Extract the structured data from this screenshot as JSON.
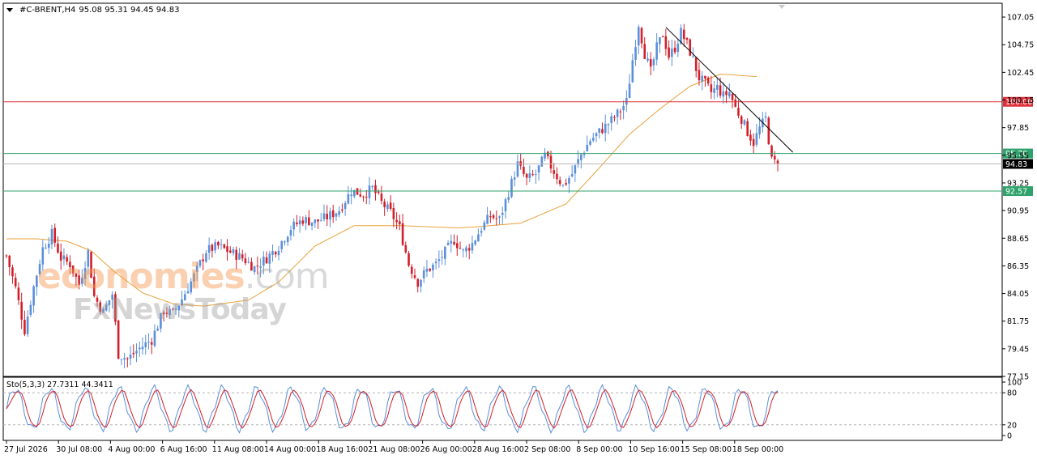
{
  "header": {
    "symbol": "#C-BRENT,H4",
    "ohlc": "95.08 95.31 94.45 94.83"
  },
  "watermark": {
    "brand_main": "economies",
    "brand_suffix": ".com",
    "brand_secondary": "FxNewsToday"
  },
  "chart_data": [
    {
      "type": "candlestick",
      "title": "#C-BRENT,H4",
      "ylim": [
        77.15,
        108.2
      ],
      "y_ticks": [
        "107.05",
        "104.75",
        "102.45",
        "100.15",
        "97.85",
        "95.55",
        "93.25",
        "90.95",
        "88.65",
        "86.35",
        "84.05",
        "81.75",
        "79.45",
        "77.15"
      ],
      "x_ticks": [
        "27 Jul 2026",
        "30 Jul 08:00",
        "4 Aug 00:00",
        "6 Aug 16:00",
        "11 Aug 08:00",
        "14 Aug 00:00",
        "18 Aug 16:00",
        "21 Aug 08:00",
        "26 Aug 00:00",
        "28 Aug 16:00",
        "2 Sep 08:00",
        "8 Sep 00:00",
        "10 Sep 16:00",
        "15 Sep 08:00",
        "18 Sep 00:00"
      ],
      "last_price": 94.83,
      "horizontal_lines": [
        {
          "label": "100.00",
          "value": 100.0,
          "color": "#e0303a"
        },
        {
          "label": "95.70",
          "value": 95.7,
          "color": "#2fa36b"
        },
        {
          "label": "92.57",
          "value": 92.57,
          "color": "#2fa36b"
        }
      ],
      "current_price_label": "94.83",
      "moving_average_path": [
        {
          "t": 0,
          "v": 88.6
        },
        {
          "t": 10,
          "v": 88.6
        },
        {
          "t": 20,
          "v": 88.4
        },
        {
          "t": 28,
          "v": 87.6
        },
        {
          "t": 36,
          "v": 85.8
        },
        {
          "t": 45,
          "v": 84.1
        },
        {
          "t": 55,
          "v": 83.2
        },
        {
          "t": 65,
          "v": 83.0
        },
        {
          "t": 80,
          "v": 83.5
        },
        {
          "t": 90,
          "v": 85.0
        },
        {
          "t": 102,
          "v": 88.0
        },
        {
          "t": 115,
          "v": 89.7
        },
        {
          "t": 130,
          "v": 89.7
        },
        {
          "t": 150,
          "v": 89.5
        },
        {
          "t": 170,
          "v": 89.9
        },
        {
          "t": 185,
          "v": 91.5
        },
        {
          "t": 196,
          "v": 94.5
        },
        {
          "t": 206,
          "v": 97.3
        },
        {
          "t": 216,
          "v": 99.4
        },
        {
          "t": 226,
          "v": 101.3
        },
        {
          "t": 236,
          "v": 102.3
        },
        {
          "t": 248,
          "v": 102.1
        }
      ],
      "trendline": {
        "t1": 218,
        "v1": 106.2,
        "t2": 260,
        "v2": 95.8,
        "color": "#000000"
      },
      "ohlc_path": [
        {
          "t": 0,
          "v": 87.2
        },
        {
          "t": 3,
          "v": 84.5
        },
        {
          "t": 6,
          "v": 81.0
        },
        {
          "t": 9,
          "v": 84.6
        },
        {
          "t": 12,
          "v": 87.8
        },
        {
          "t": 15,
          "v": 89.0
        },
        {
          "t": 18,
          "v": 87.0
        },
        {
          "t": 21,
          "v": 86.5
        },
        {
          "t": 24,
          "v": 84.8
        },
        {
          "t": 27,
          "v": 87.5
        },
        {
          "t": 29,
          "v": 83.8
        },
        {
          "t": 32,
          "v": 82.5
        },
        {
          "t": 35,
          "v": 84.0
        },
        {
          "t": 37,
          "v": 79.0
        },
        {
          "t": 40,
          "v": 78.6
        },
        {
          "t": 44,
          "v": 79.5
        },
        {
          "t": 48,
          "v": 80.2
        },
        {
          "t": 52,
          "v": 82.6
        },
        {
          "t": 55,
          "v": 82.4
        },
        {
          "t": 58,
          "v": 83.6
        },
        {
          "t": 62,
          "v": 85.5
        },
        {
          "t": 66,
          "v": 87.6
        },
        {
          "t": 70,
          "v": 88.0
        },
        {
          "t": 74,
          "v": 87.5
        },
        {
          "t": 78,
          "v": 87.0
        },
        {
          "t": 82,
          "v": 86.2
        },
        {
          "t": 86,
          "v": 87.0
        },
        {
          "t": 90,
          "v": 88.0
        },
        {
          "t": 94,
          "v": 89.5
        },
        {
          "t": 98,
          "v": 90.2
        },
        {
          "t": 102,
          "v": 90.0
        },
        {
          "t": 106,
          "v": 90.4
        },
        {
          "t": 110,
          "v": 91.0
        },
        {
          "t": 114,
          "v": 92.6
        },
        {
          "t": 118,
          "v": 92.3
        },
        {
          "t": 121,
          "v": 92.8
        },
        {
          "t": 124,
          "v": 91.6
        },
        {
          "t": 127,
          "v": 90.8
        },
        {
          "t": 130,
          "v": 89.5
        },
        {
          "t": 133,
          "v": 86.5
        },
        {
          "t": 136,
          "v": 85.0
        },
        {
          "t": 139,
          "v": 86.0
        },
        {
          "t": 142,
          "v": 86.5
        },
        {
          "t": 145,
          "v": 87.5
        },
        {
          "t": 148,
          "v": 88.5
        },
        {
          "t": 151,
          "v": 87.5
        },
        {
          "t": 154,
          "v": 88.2
        },
        {
          "t": 157,
          "v": 89.5
        },
        {
          "t": 160,
          "v": 90.5
        },
        {
          "t": 163,
          "v": 90.2
        },
        {
          "t": 166,
          "v": 92.5
        },
        {
          "t": 169,
          "v": 94.8
        },
        {
          "t": 172,
          "v": 93.5
        },
        {
          "t": 175,
          "v": 94.0
        },
        {
          "t": 178,
          "v": 95.5
        },
        {
          "t": 181,
          "v": 94.2
        },
        {
          "t": 184,
          "v": 93.0
        },
        {
          "t": 187,
          "v": 94.0
        },
        {
          "t": 190,
          "v": 95.6
        },
        {
          "t": 193,
          "v": 96.8
        },
        {
          "t": 196,
          "v": 97.5
        },
        {
          "t": 199,
          "v": 98.2
        },
        {
          "t": 202,
          "v": 99.0
        },
        {
          "t": 205,
          "v": 100.0
        },
        {
          "t": 207,
          "v": 103.5
        },
        {
          "t": 209,
          "v": 106.5
        },
        {
          "t": 211,
          "v": 104.0
        },
        {
          "t": 213,
          "v": 102.5
        },
        {
          "t": 215,
          "v": 104.5
        },
        {
          "t": 217,
          "v": 105.6
        },
        {
          "t": 219,
          "v": 103.8
        },
        {
          "t": 221,
          "v": 104.5
        },
        {
          "t": 223,
          "v": 105.8
        },
        {
          "t": 225,
          "v": 104.8
        },
        {
          "t": 227,
          "v": 103.5
        },
        {
          "t": 229,
          "v": 102.0
        },
        {
          "t": 231,
          "v": 101.5
        },
        {
          "t": 233,
          "v": 100.8
        },
        {
          "t": 235,
          "v": 101.2
        },
        {
          "t": 237,
          "v": 100.5
        },
        {
          "t": 239,
          "v": 100.8
        },
        {
          "t": 241,
          "v": 99.5
        },
        {
          "t": 243,
          "v": 98.6
        },
        {
          "t": 245,
          "v": 97.5
        },
        {
          "t": 247,
          "v": 96.6
        },
        {
          "t": 249,
          "v": 97.8
        },
        {
          "t": 251,
          "v": 98.6
        },
        {
          "t": 253,
          "v": 95.1
        },
        {
          "t": 255,
          "v": 94.83
        }
      ]
    },
    {
      "type": "line",
      "title": "Sto(5,3,3) 27.7311 44.3411",
      "indicator_label": "Sto(5,3,3) 27.7311 44.3411",
      "ylim": [
        0,
        100
      ],
      "y_ticks": [
        "100",
        "80",
        "20",
        "0"
      ],
      "levels": [
        80,
        20
      ],
      "series": [
        {
          "name": "",
          "color": "#5b8fd9"
        },
        {
          "name": "",
          "color": "#d1202a"
        }
      ]
    }
  ],
  "colors": {
    "bull": "#5b8fd9",
    "bear": "#d1202a",
    "ma": "#e8a23a",
    "grid": "#d0d0d0",
    "axis": "#000000",
    "level_dash": "#b0b0b0"
  }
}
